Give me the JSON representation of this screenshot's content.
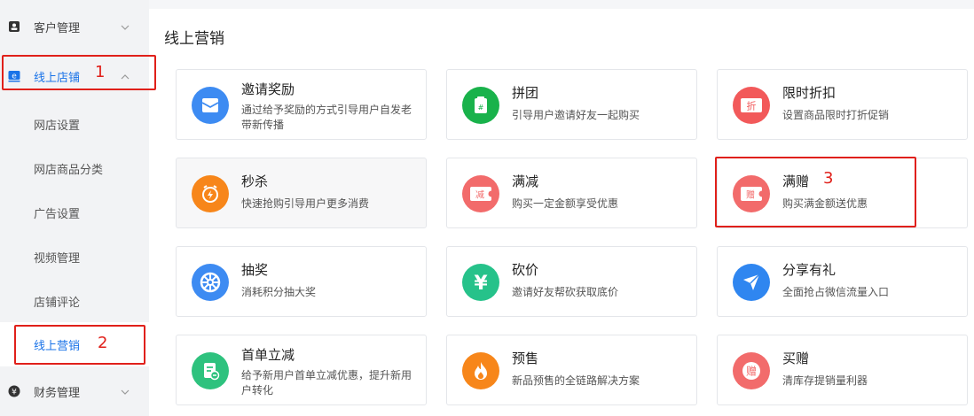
{
  "sidebar": {
    "customer": "客户管理",
    "online_store": "线上店铺",
    "sub": [
      "网店设置",
      "网店商品分类",
      "广告设置",
      "视频管理",
      "店铺评论",
      "线上营销"
    ],
    "finance": "财务管理"
  },
  "annotations": {
    "one": "1",
    "two": "2",
    "three": "3"
  },
  "page": {
    "title": "线上营销"
  },
  "cards": [
    {
      "title": "邀请奖励",
      "desc": "通过给予奖励的方式引导用户自发老带新传播",
      "icon": "envelope-icon",
      "color": "#3d8bf2"
    },
    {
      "title": "拼团",
      "desc": "引导用户邀请好友一起购买",
      "icon": "group-buy-icon",
      "color": "#19b24b"
    },
    {
      "title": "限时折扣",
      "desc": "设置商品限时打折促销",
      "icon": "discount-ticket-icon",
      "color": "#f2595a",
      "icon_text": "折"
    },
    {
      "title": "秒杀",
      "desc": "快速抢购引导用户更多消费",
      "icon": "flash-sale-icon",
      "color": "#f7861a"
    },
    {
      "title": "满减",
      "desc": "购买一定金额享受优惠",
      "icon": "reduce-ticket-icon",
      "color": "#f26b6b",
      "icon_text": "减"
    },
    {
      "title": "满赠",
      "desc": "购买满金额送优惠",
      "icon": "gift-ticket-icon",
      "color": "#f26b6b",
      "icon_text": "赠"
    },
    {
      "title": "抽奖",
      "desc": "消耗积分抽大奖",
      "icon": "lottery-wheel-icon",
      "color": "#3d8bf2"
    },
    {
      "title": "砍价",
      "desc": "邀请好友帮砍获取底价",
      "icon": "yuan-icon",
      "color": "#26c28a",
      "icon_text": "¥"
    },
    {
      "title": "分享有礼",
      "desc": "全面抢占微信流量入口",
      "icon": "share-plane-icon",
      "color": "#2f86f0"
    },
    {
      "title": "首单立减",
      "desc": "给予新用户首单立减优惠，提升新用户转化",
      "icon": "first-order-icon",
      "color": "#2ec27e"
    },
    {
      "title": "预售",
      "desc": "新品预售的全链路解决方案",
      "icon": "fire-icon",
      "color": "#f7861a"
    },
    {
      "title": "买赠",
      "desc": "清库存提销量利器",
      "icon": "buy-gift-icon",
      "color": "#f26b6b",
      "icon_text": "赠"
    }
  ]
}
